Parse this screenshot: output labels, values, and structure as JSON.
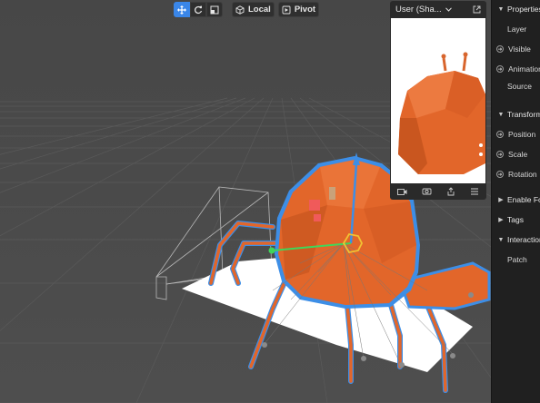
{
  "toolbar": {
    "local_label": "Local",
    "pivot_label": "Pivot",
    "tools": [
      {
        "name": "move-tool",
        "icon": "move-icon",
        "active": true
      },
      {
        "name": "rotate-tool",
        "icon": "rotate-icon",
        "active": false
      },
      {
        "name": "scale-tool",
        "icon": "scale-icon",
        "active": false
      }
    ]
  },
  "preview": {
    "title": "User (Sha...",
    "footer_icons": [
      "video-camera-icon",
      "screenshot-icon",
      "share-icon",
      "menu-icon"
    ]
  },
  "panel": {
    "sections": {
      "properties": "Properties",
      "transform": "Transform",
      "enable_for": "Enable Fo",
      "tags": "Tags",
      "interaction": "Interaction"
    },
    "rows": {
      "layer": "Layer",
      "visible": "Visible",
      "animation": "Animation",
      "source": "Source",
      "position": "Position",
      "scale": "Scale",
      "rotation": "Rotation",
      "patch": "Patch"
    }
  },
  "colors": {
    "accent": "#3a86e8",
    "object": "#e2662a",
    "viewport": "#4a4a4a",
    "panel": "#202020"
  }
}
